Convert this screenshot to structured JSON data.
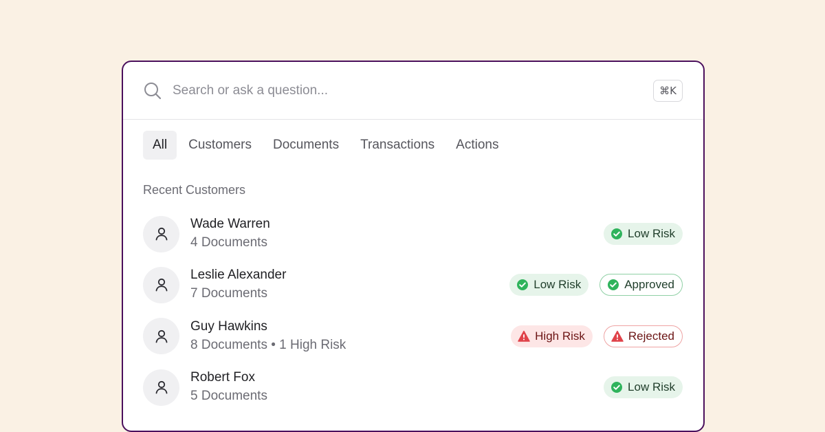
{
  "search": {
    "placeholder": "Search or ask a question...",
    "shortcut": "⌘K"
  },
  "tabs": [
    {
      "label": "All",
      "active": true
    },
    {
      "label": "Customers",
      "active": false
    },
    {
      "label": "Documents",
      "active": false
    },
    {
      "label": "Transactions",
      "active": false
    },
    {
      "label": "Actions",
      "active": false
    }
  ],
  "section": {
    "title": "Recent Customers"
  },
  "customers": [
    {
      "name": "Wade Warren",
      "meta": "4 Documents",
      "badges": [
        {
          "label": "Low Risk",
          "type": "low",
          "icon": "check-circle-icon"
        }
      ]
    },
    {
      "name": "Leslie Alexander",
      "meta": "7 Documents",
      "badges": [
        {
          "label": "Low Risk",
          "type": "low",
          "icon": "check-circle-icon"
        },
        {
          "label": "Approved",
          "type": "approved",
          "icon": "check-circle-icon"
        }
      ]
    },
    {
      "name": "Guy Hawkins",
      "meta": "8 Documents • 1 High Risk",
      "badges": [
        {
          "label": "High Risk",
          "type": "high",
          "icon": "warning-triangle-icon"
        },
        {
          "label": "Rejected",
          "type": "rejected",
          "icon": "warning-triangle-icon"
        }
      ]
    },
    {
      "name": "Robert Fox",
      "meta": "5 Documents",
      "badges": [
        {
          "label": "Low Risk",
          "type": "low",
          "icon": "check-circle-icon"
        }
      ]
    }
  ],
  "colors": {
    "background": "#faf1e4",
    "panel_border": "#4a0f5c",
    "success": "#2fb35c",
    "danger": "#e0434a"
  }
}
